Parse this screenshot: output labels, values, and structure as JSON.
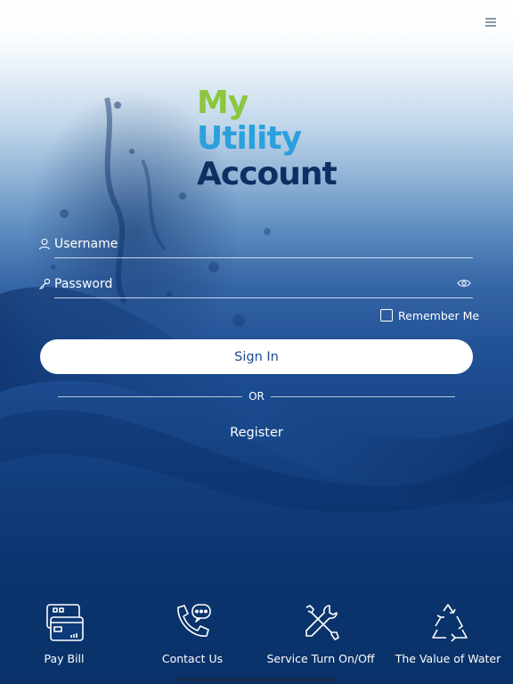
{
  "logo": {
    "line1": "My",
    "line2": "Utility",
    "line3": "Account"
  },
  "login": {
    "username_placeholder": "Username",
    "password_placeholder": "Password",
    "remember_label": "Remember Me",
    "signin_label": "Sign In",
    "or_text": "OR",
    "register_label": "Register"
  },
  "quick_links": [
    {
      "label": "Pay Bill",
      "icon": "credit-card-icon"
    },
    {
      "label": "Contact Us",
      "icon": "phone-chat-icon"
    },
    {
      "label": "Service Turn On/Off",
      "icon": "tools-icon"
    },
    {
      "label": "The Value of Water",
      "icon": "recycle-icon"
    }
  ],
  "colors": {
    "logo_my": "#8cc63f",
    "logo_utility": "#2aa0dc",
    "logo_account": "#0d2f63",
    "signin_text": "#1a4b8c",
    "background_deep": "#0a3169"
  }
}
